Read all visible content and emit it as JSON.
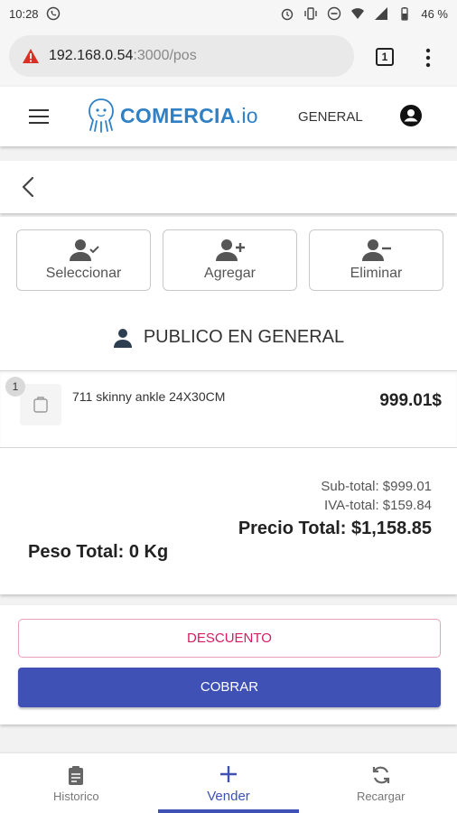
{
  "status_bar": {
    "time": "10:28",
    "battery": "46 %"
  },
  "browser": {
    "url_host": "192.168.0.54",
    "url_path": ":3000/pos",
    "tab_count": "1"
  },
  "app": {
    "brand": "COMERCIA",
    "brand_suffix": ".io",
    "store": "GENERAL"
  },
  "actions": {
    "select_label": "Seleccionar",
    "add_label": "Agregar",
    "remove_label": "Eliminar"
  },
  "client": {
    "name": "PUBLICO EN GENERAL"
  },
  "cart": {
    "items": [
      {
        "qty": "1",
        "name": "711 skinny ankle 24X30CM",
        "price": "999.01$"
      }
    ]
  },
  "totals": {
    "subtotal": "Sub-total: $999.01",
    "iva": "IVA-total: $159.84",
    "grand": "Precio Total: $1,158.85",
    "weight": "Peso Total: 0 Kg"
  },
  "buttons": {
    "discount": "DESCUENTO",
    "charge": "COBRAR"
  },
  "nav": {
    "history": "Historico",
    "sell": "Vender",
    "recharge": "Recargar"
  },
  "colors": {
    "primary": "#3f51b5",
    "brand_blue": "#2f80c5",
    "discount_pink": "#d81b60",
    "warning_red": "#d93025"
  }
}
